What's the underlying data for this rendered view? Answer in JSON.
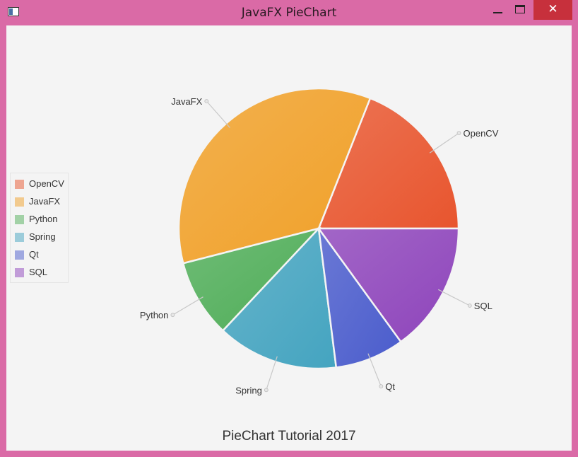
{
  "window": {
    "title": "JavaFX PieChart",
    "icons": {
      "app": "window-app-icon",
      "minimize": "minimize-icon",
      "maximize": "maximize-icon",
      "close": "close-icon"
    },
    "close_glyph": "✕"
  },
  "chart_data": {
    "type": "pie",
    "title": "PieChart Tutorial 2017",
    "legend_position": "left",
    "categories": [
      "OpenCV",
      "JavaFX",
      "Python",
      "Spring",
      "Qt",
      "SQL"
    ],
    "values": [
      19,
      35,
      9,
      14,
      8,
      15
    ],
    "colors": [
      "#e8552e",
      "#f0a028",
      "#4fad58",
      "#44a4c0",
      "#4a5ccc",
      "#8e44bb"
    ],
    "start_angle_deg": 0,
    "direction": "counterclockwise"
  }
}
